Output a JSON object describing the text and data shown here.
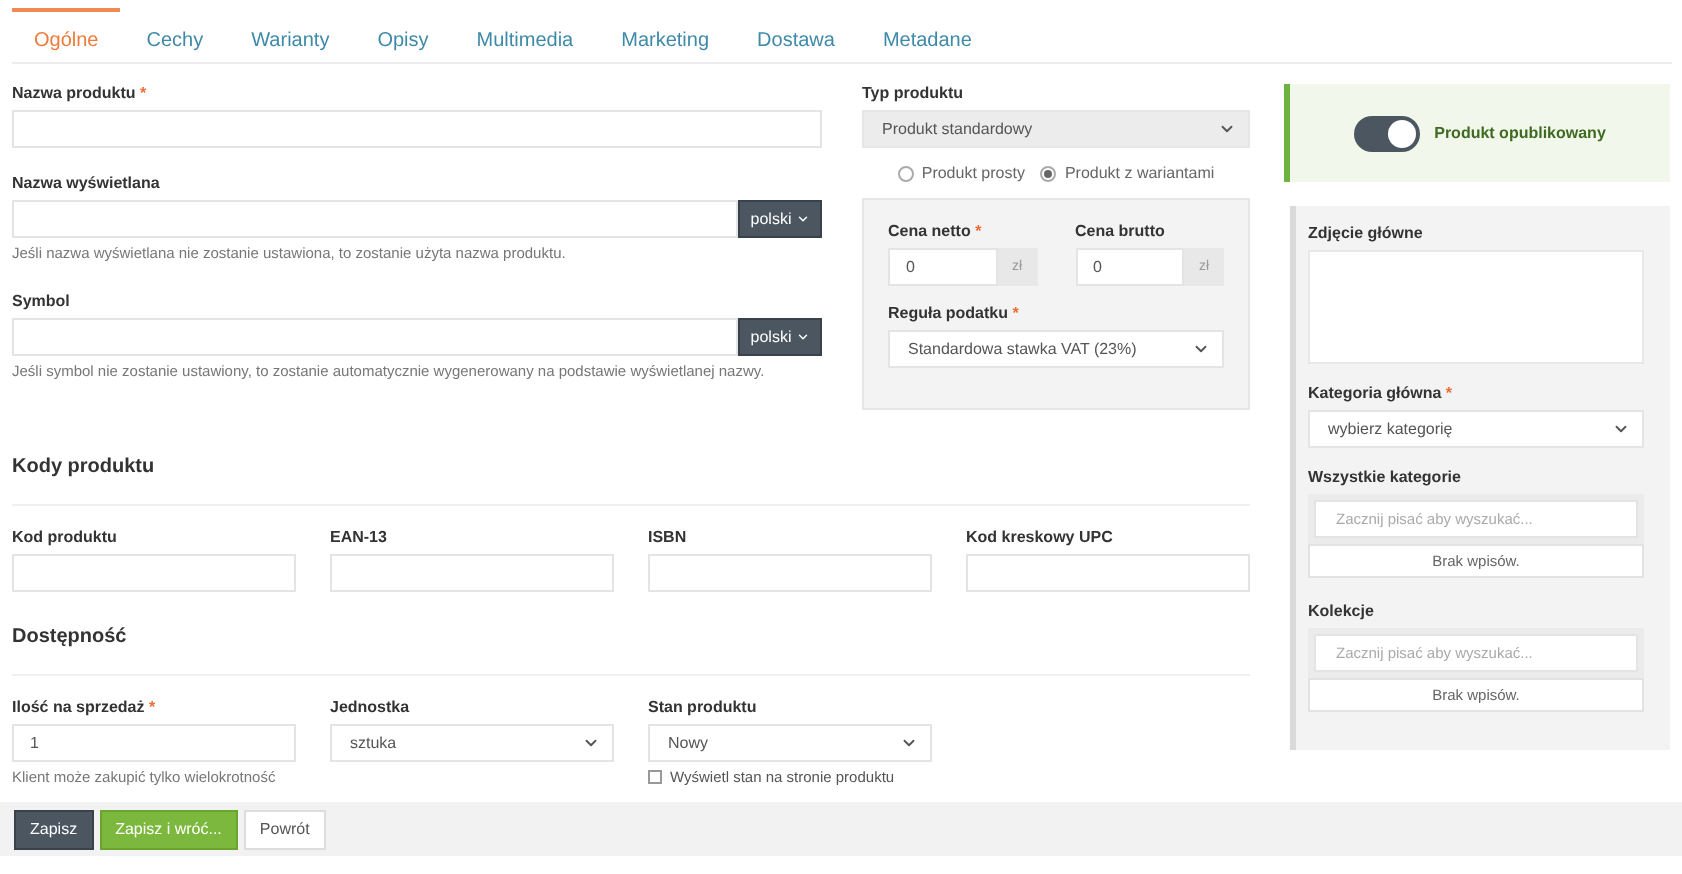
{
  "tabs": [
    {
      "label": "Ogólne",
      "selected": true
    },
    {
      "label": "Cechy",
      "selected": false
    },
    {
      "label": "Warianty",
      "selected": false
    },
    {
      "label": "Opisy",
      "selected": false
    },
    {
      "label": "Multimedia",
      "selected": false
    },
    {
      "label": "Marketing",
      "selected": false
    },
    {
      "label": "Dostawa",
      "selected": false
    },
    {
      "label": "Metadane",
      "selected": false
    }
  ],
  "basic_fields": [
    {
      "label": "Nazwa produktu",
      "marker": "*"
    },
    {
      "label": "Nazwa wyświetlana",
      "language": "polski",
      "hint": "Jeśli nazwa wyświetlana nie zostanie ustawiona, to zostanie użyta nazwa produktu."
    },
    {
      "label": "Symbol",
      "language": "polski",
      "hint": "Jeśli symbol nie zostanie ustawiony, to zostanie automatycznie wygenerowany na podstawie wyświetlanej nazwy."
    }
  ],
  "product_type": {
    "label": "Typ produktu",
    "value": "Produkt standardowy",
    "options": [
      {
        "label": "Produkt prosty",
        "selected": false
      },
      {
        "label": "Produkt z wariantami",
        "selected": true
      }
    ]
  },
  "pricing": {
    "prices": [
      {
        "label": "Cena netto",
        "marker": "*",
        "value": "0",
        "unit": "zł"
      },
      {
        "label": "Cena brutto",
        "value": "0",
        "unit": "zł"
      }
    ],
    "tax": {
      "label": "Reguła podatku",
      "marker": "*",
      "value": "Standardowa stawka VAT (23%)"
    }
  },
  "codes": {
    "title": "Kody produktu",
    "fields": [
      {
        "label": "Kod produktu"
      },
      {
        "label": "EAN-13"
      },
      {
        "label": "ISBN"
      },
      {
        "label": "Kod kreskowy UPC"
      }
    ]
  },
  "availability": {
    "title": "Dostępność",
    "fields": [
      {
        "kind": "input",
        "label": "Ilość na sprzedaż",
        "marker": "*",
        "value": "1",
        "hint": "Klient może zakupić tylko wielokrotność"
      },
      {
        "kind": "select",
        "label": "Jednostka",
        "value": "sztuka"
      },
      {
        "kind": "select",
        "label": "Stan produktu",
        "value": "Nowy",
        "checkbox": {
          "label": "Wyświetl stan na stronie produktu",
          "checked": false
        }
      }
    ]
  },
  "publish": {
    "label": "Produkt opublikowany",
    "on": true
  },
  "sidebar": {
    "image_label": "Zdjęcie główne",
    "main_category": {
      "label": "Kategoria główna",
      "marker": "*",
      "value": "wybierz kategorię"
    },
    "pickers": [
      {
        "label": "Wszystkie kategorie",
        "placeholder": "Zacznij pisać aby wyszukać...",
        "empty": "Brak wpisów."
      },
      {
        "label": "Kolekcje",
        "placeholder": "Zacznij pisać aby wyszukać...",
        "empty": "Brak wpisów."
      }
    ]
  },
  "footer": {
    "buttons": [
      {
        "kind": "primary",
        "label": "Zapisz"
      },
      {
        "kind": "success",
        "label": "Zapisz i wróć..."
      },
      {
        "kind": "default",
        "label": "Powrót"
      }
    ]
  }
}
